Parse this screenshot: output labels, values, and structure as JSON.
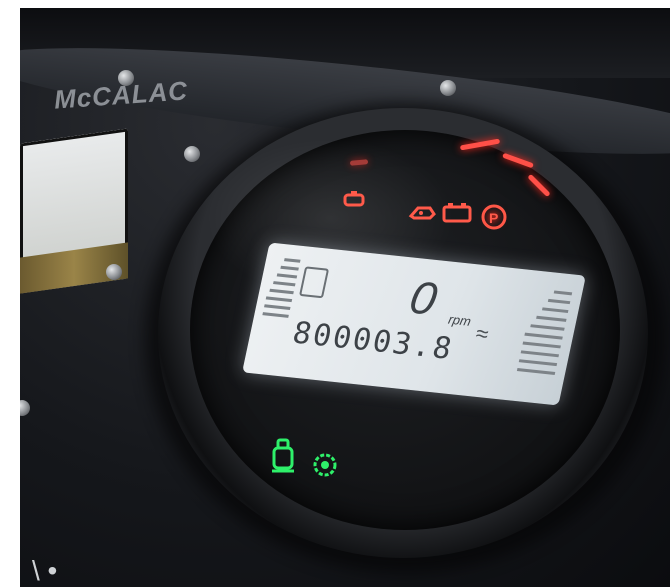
{
  "photo": {
    "brand_logo": "McCALAC",
    "display": {
      "rpm_value": "0",
      "rpm_unit": "rpm",
      "hour_meter": "800003.8"
    },
    "warning_lights": [
      "engine-icon",
      "oil-pressure-icon",
      "battery-icon",
      "parking-brake-icon"
    ],
    "indicator_lights": [
      "fuel-pump-icon",
      "gear-icon"
    ],
    "colors": {
      "warning": "#ff5a4a",
      "indicator": "#2ef06a",
      "lcd_backlight": "#e6ebef",
      "dashboard": "#16181c"
    }
  }
}
